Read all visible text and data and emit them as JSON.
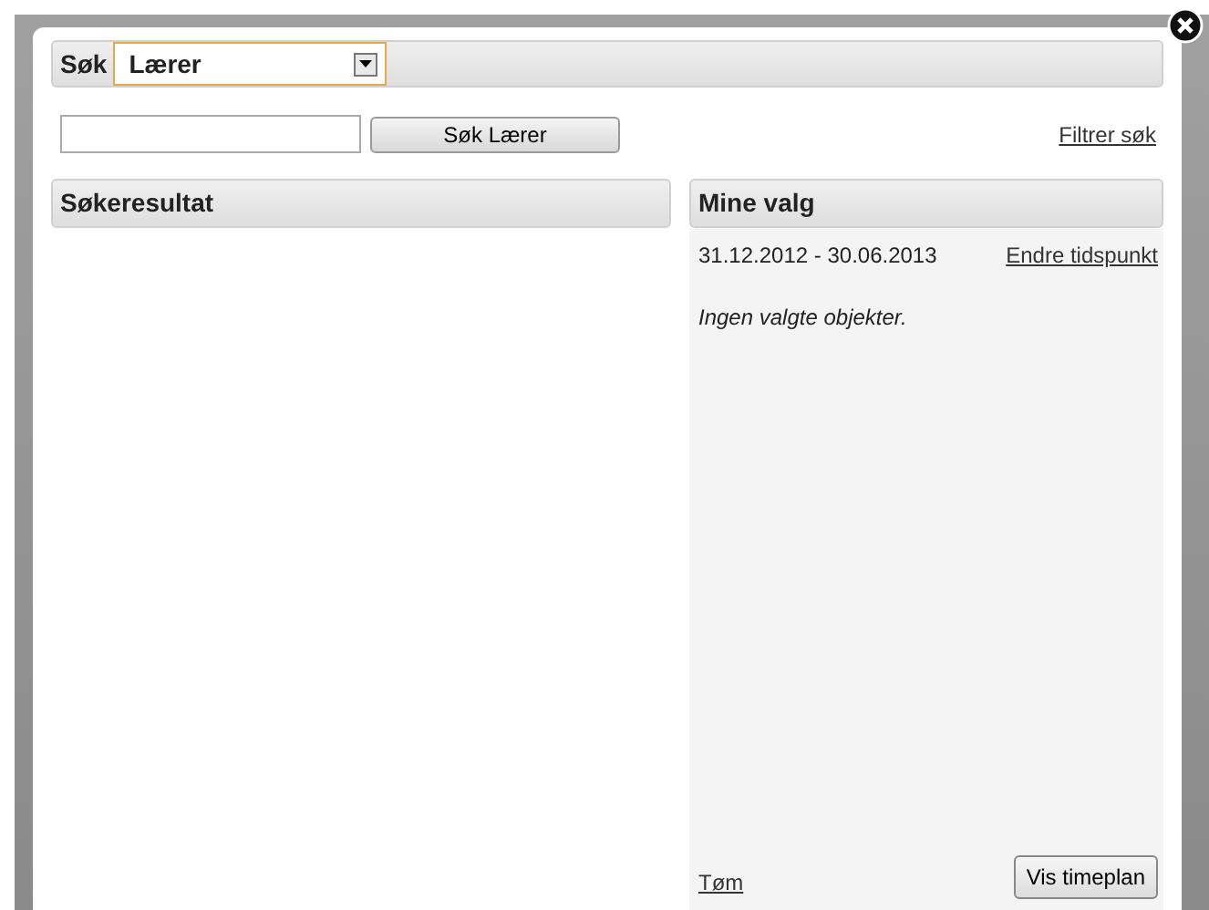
{
  "search_bar": {
    "label": "Søk",
    "select_value": "Lærer"
  },
  "search_row": {
    "button": "Søk Lærer",
    "filter_link": "Filtrer søk"
  },
  "results": {
    "title": "Søkeresultat"
  },
  "my_choices": {
    "title": "Mine valg",
    "period": "31.12.2012 - 30.06.2013",
    "change_link": "Endre tidspunkt",
    "empty_text": "Ingen valgte objekter.",
    "clear_link": "Tøm",
    "show_button": "Vis timeplan"
  }
}
